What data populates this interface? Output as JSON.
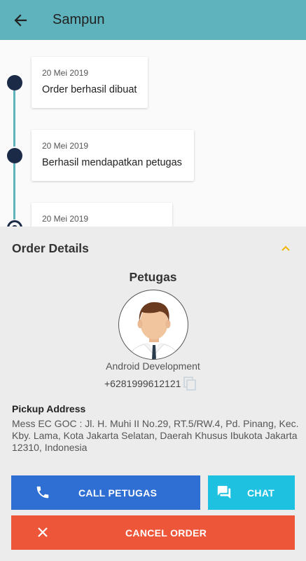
{
  "app_bar": {
    "title": "Sampun",
    "back_icon": "arrow-back-icon"
  },
  "timeline": [
    {
      "date": "20 Mei 2019",
      "message": "Order berhasil dibuat"
    },
    {
      "date": "20 Mei 2019",
      "message": "Berhasil mendapatkan petugas"
    },
    {
      "date": "20 Mei 2019",
      "message": ""
    }
  ],
  "order_details": {
    "title": "Order Details",
    "toggle_icon": "chevron-up-icon",
    "petugas_title": "Petugas",
    "petugas_name": "Android Development",
    "petugas_phone": "+6281999612121",
    "pickup_label": "Pickup Address",
    "pickup_address": "Mess EC GOC : Jl. H. Muhi II No.29, RT.5/RW.4, Pd. Pinang, Kec. Kby. Lama, Kota Jakarta Selatan, Daerah Khusus Ibukota Jakarta 12310, Indonesia"
  },
  "buttons": {
    "call": "CALL PETUGAS",
    "chat": "CHAT",
    "cancel": "CANCEL ORDER"
  },
  "colors": {
    "app_bar": "#5fb3bd",
    "timeline_dot": "#1b2a47",
    "accent_chevron": "#f2b600",
    "call_button": "#2f6fd4",
    "chat_button": "#1ec1e0",
    "cancel_button": "#ee563a"
  }
}
